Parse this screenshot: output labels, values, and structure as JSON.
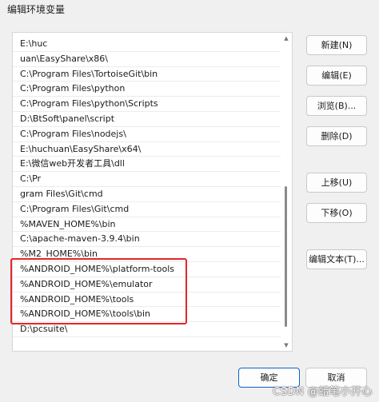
{
  "window": {
    "title": "编辑环境变量"
  },
  "list": {
    "items": [
      "E:\\huc",
      "uan\\EasyShare\\x86\\",
      "C:\\Program Files\\TortoiseGit\\bin",
      "C:\\Program Files\\python",
      "C:\\Program Files\\python\\Scripts",
      "D:\\BtSoft\\panel\\script",
      "C:\\Program Files\\nodejs\\",
      "E:\\huchuan\\EasyShare\\x64\\",
      "E:\\微信web开发者工具\\dll",
      "C:\\Pr",
      "gram Files\\Git\\cmd",
      "C:\\Program Files\\Git\\cmd",
      "%MAVEN_HOME%\\bin",
      "C:\\apache-maven-3.9.4\\bin",
      "%M2_HOME%\\bin",
      "%ANDROID_HOME%\\platform-tools",
      "%ANDROID_HOME%\\emulator",
      "%ANDROID_HOME%\\tools",
      "%ANDROID_HOME%\\tools\\bin",
      "D:\\pcsuite\\"
    ],
    "highlight_color": "#e3262a"
  },
  "buttons": {
    "new": "新建(N)",
    "edit": "编辑(E)",
    "browse": "浏览(B)...",
    "delete": "删除(D)",
    "move_up": "上移(U)",
    "move_down": "下移(O)",
    "edit_text": "编辑文本(T)...",
    "ok": "确定",
    "cancel": "取消"
  },
  "watermark": "CSDN @蜡笔小开心",
  "colors": {
    "primary_border": "#0a64c8"
  }
}
